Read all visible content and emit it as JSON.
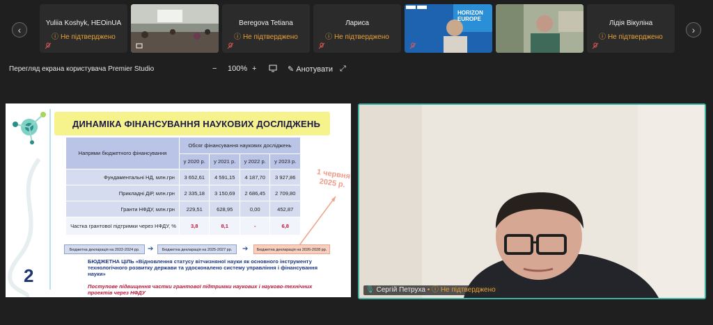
{
  "participants": [
    {
      "name": "Yuliia Koshyk, HEOinUA",
      "status": "Не підтверджено"
    },
    {
      "name": "Beregova Tetiana",
      "status": "Не підтверджено"
    },
    {
      "name": "Лариса",
      "status": "Не підтверджено"
    },
    {
      "name": "Лідія Вікуліна",
      "status": "Не підтверджено"
    }
  ],
  "video_tile_text": {
    "horizon": "HORIZON EUROPE"
  },
  "toolbar": {
    "share_title": "Перегляд екрана користувача Premier Studio",
    "zoom_minus": "−",
    "zoom_level": "100%",
    "zoom_plus": "+",
    "annotate_label": "Анотувати"
  },
  "slide": {
    "title": "ДИНАМІКА ФІНАНСУВАННЯ НАУКОВИХ ДОСЛІДЖЕНЬ",
    "number": "2",
    "table": {
      "col_header_left": "Напрями бюджетного фінансування",
      "col_header_group": "Обсяг фінансування наукових досліджень",
      "years": [
        "у 2020 р.",
        "у 2021 р.",
        "у 2022 р.",
        "у 2023 р."
      ],
      "rows": [
        {
          "label": "Фундаментальні НД, млн.грн",
          "values": [
            "3 652,61",
            "4 591,15",
            "4 187,70",
            "3 927,86"
          ]
        },
        {
          "label": "Прикладні ДіР, млн.грн",
          "values": [
            "2 335,18",
            "3 150,69",
            "2 686,45",
            "2 709,80"
          ]
        },
        {
          "label": "Гранти НФДУ, млн.грн",
          "values": [
            "229,51",
            "628,95",
            "0,00",
            "452,87"
          ]
        }
      ],
      "share_row": {
        "label": "Частка грантової підтримки через НФДУ, %",
        "values": [
          "3,8",
          "8,1",
          "-",
          "6,8"
        ]
      }
    },
    "callout": "1 червня 2025 р.",
    "declarations": [
      "Бюджетна декларація на 2022-2024 рр.",
      "Бюджетна декларація на 2025-2027 рр.",
      "Бюджетна декларація на 2026-2028 рр."
    ],
    "goal": "БЮДЖЕТНА ЦІЛЬ «Відновлення статусу вітчизняної науки як основного інструменту технологічного розвитку держави та удосконалено систему управління і фінансування науки»",
    "goal_italic": "Поступове підвищення частки грантової підтримки наукових і науково-технічних проектів через НФДУ"
  },
  "speaker": {
    "name": "Сергій Петруха",
    "separator": "•",
    "status": "Не підтверджено"
  },
  "colors": {
    "accent": "#3fb6a4",
    "status": "#e8a23a",
    "slide_red": "#c0163a",
    "slide_blue": "#1c3684"
  }
}
